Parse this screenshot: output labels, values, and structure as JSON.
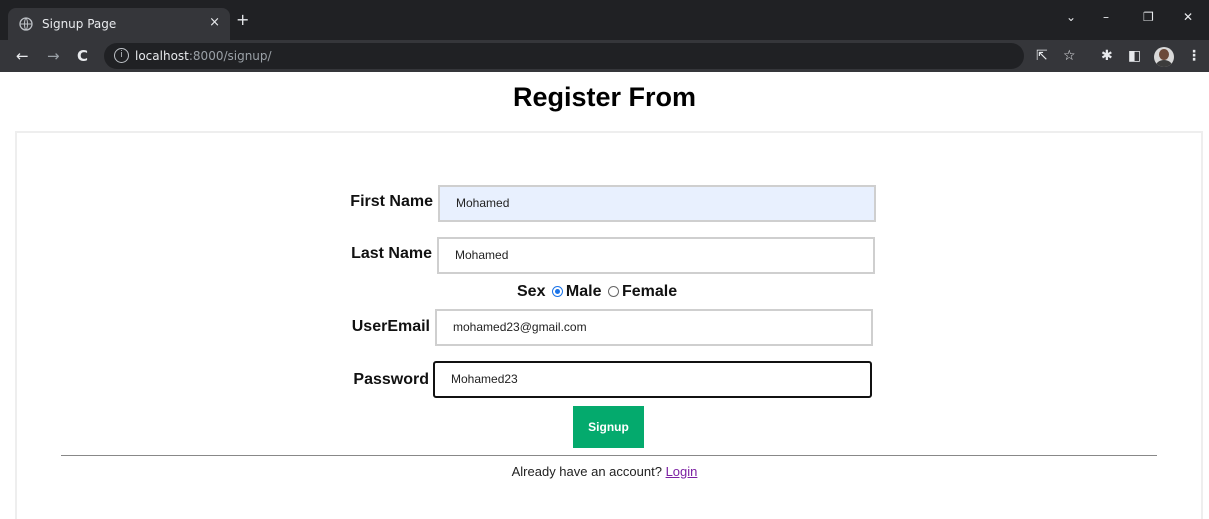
{
  "browser": {
    "tab_title": "Signup Page",
    "tab_close": "×",
    "new_tab": "+",
    "url_host": "localhost",
    "url_path": ":8000/signup/",
    "window_controls": {
      "chevron": "⌄",
      "minimize": "–",
      "restore": "❐",
      "close": "✕"
    },
    "nav": {
      "back": "←",
      "forward": "→",
      "reload": "C"
    },
    "toolbar_icons": {
      "share": "⇱",
      "star": "☆",
      "extensions": "✱",
      "sidepanel": "◧",
      "menu": "⋮"
    }
  },
  "page": {
    "title": "Register From"
  },
  "form": {
    "first_name_label": "First Name",
    "first_name_value": "Mohamed",
    "last_name_label": "Last Name",
    "last_name_value": "Mohamed",
    "sex_label": "Sex",
    "sex_options": [
      "Male",
      "Female"
    ],
    "sex_selected": "Male",
    "email_label": "UserEmail",
    "email_value": "mohamed23@gmail.com",
    "password_label": "Password",
    "password_value": "Mohamed23",
    "submit_label": "Signup"
  },
  "footer": {
    "prompt": "Already have an account?",
    "login_link": "Login"
  },
  "colors": {
    "button_bg": "#04aa6d",
    "link": "#7b1fa2",
    "radio_accent": "#1a73e8",
    "autofill_bg": "#e8f0fe"
  }
}
